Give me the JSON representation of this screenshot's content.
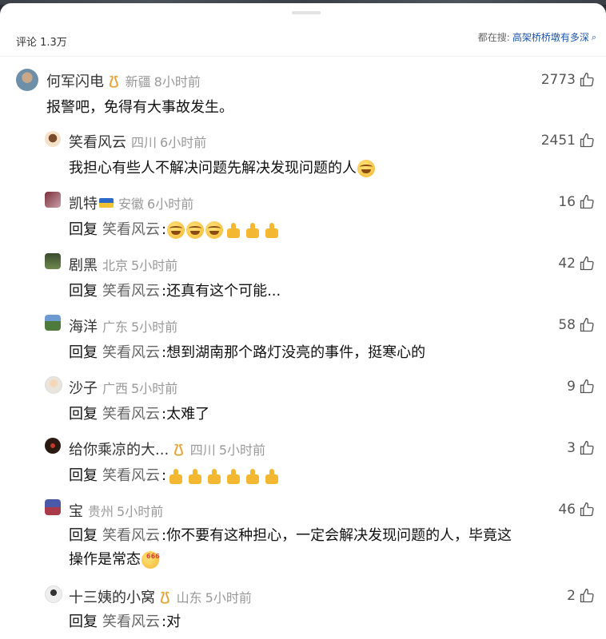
{
  "header": {
    "comment_count_label": "评论 1.3万",
    "search_prefix": "都在搜:",
    "search_term": "高架桥桥墩有多深"
  },
  "colors": {
    "badge": "#e8a53b",
    "link": "#1c56a8",
    "meta_gray": "#999999"
  },
  "comments": [
    {
      "name": "何军闪电",
      "badge": true,
      "location": "新疆",
      "time": "8小时前",
      "likes": "2773",
      "text": "报警吧，免得有大事故发生。"
    },
    {
      "name": "笑看风云",
      "location": "四川",
      "time": "6小时前",
      "likes": "2451",
      "text": "我担心有些人不解决问题先解决发现问题的人",
      "emoji": [
        "laugh-emoji"
      ]
    },
    {
      "name": "凯特",
      "flag": "ukraine-flag-icon",
      "location": "安徽",
      "time": "6小时前",
      "likes": "16",
      "reply_word": "回复",
      "mention": "笑看风云",
      "text": ":",
      "emoji": [
        "laugh-emoji",
        "laugh-emoji",
        "laugh-emoji",
        "thumbs-up-emoji",
        "thumbs-up-emoji",
        "thumbs-up-emoji"
      ]
    },
    {
      "name": "剧黑",
      "location": "北京",
      "time": "5小时前",
      "likes": "42",
      "reply_word": "回复",
      "mention": "笑看风云",
      "text": ":还真有这个可能..."
    },
    {
      "name": "海洋",
      "location": "广东",
      "time": "5小时前",
      "likes": "58",
      "reply_word": "回复",
      "mention": "笑看风云",
      "text": ":想到湖南那个路灯没亮的事件，挺寒心的"
    },
    {
      "name": "沙子",
      "location": "广西",
      "time": "5小时前",
      "likes": "9",
      "reply_word": "回复",
      "mention": "笑看风云",
      "text": ":太难了"
    },
    {
      "name": "给你乘凉的大...",
      "badge": true,
      "location": "四川",
      "time": "5小时前",
      "likes": "3",
      "reply_word": "回复",
      "mention": "笑看风云",
      "text": ":",
      "emoji": [
        "thumbs-up-emoji",
        "thumbs-up-emoji",
        "thumbs-up-emoji",
        "thumbs-up-emoji",
        "thumbs-up-emoji",
        "thumbs-up-emoji"
      ]
    },
    {
      "name": "宝",
      "location": "贵州",
      "time": "5小时前",
      "likes": "46",
      "reply_word": "回复",
      "mention": "笑看风云",
      "text": ":你不要有这种担心，一定会解决发现问题的人，毕竟这",
      "text_line2": "操作是常态",
      "emoji_line2": [
        "666-emoji"
      ]
    },
    {
      "name": "十三姨的小窝",
      "badge": true,
      "location": "山东",
      "time": "5小时前",
      "likes": "2",
      "reply_word": "回复",
      "mention": "笑看风云",
      "text": ":对"
    }
  ]
}
